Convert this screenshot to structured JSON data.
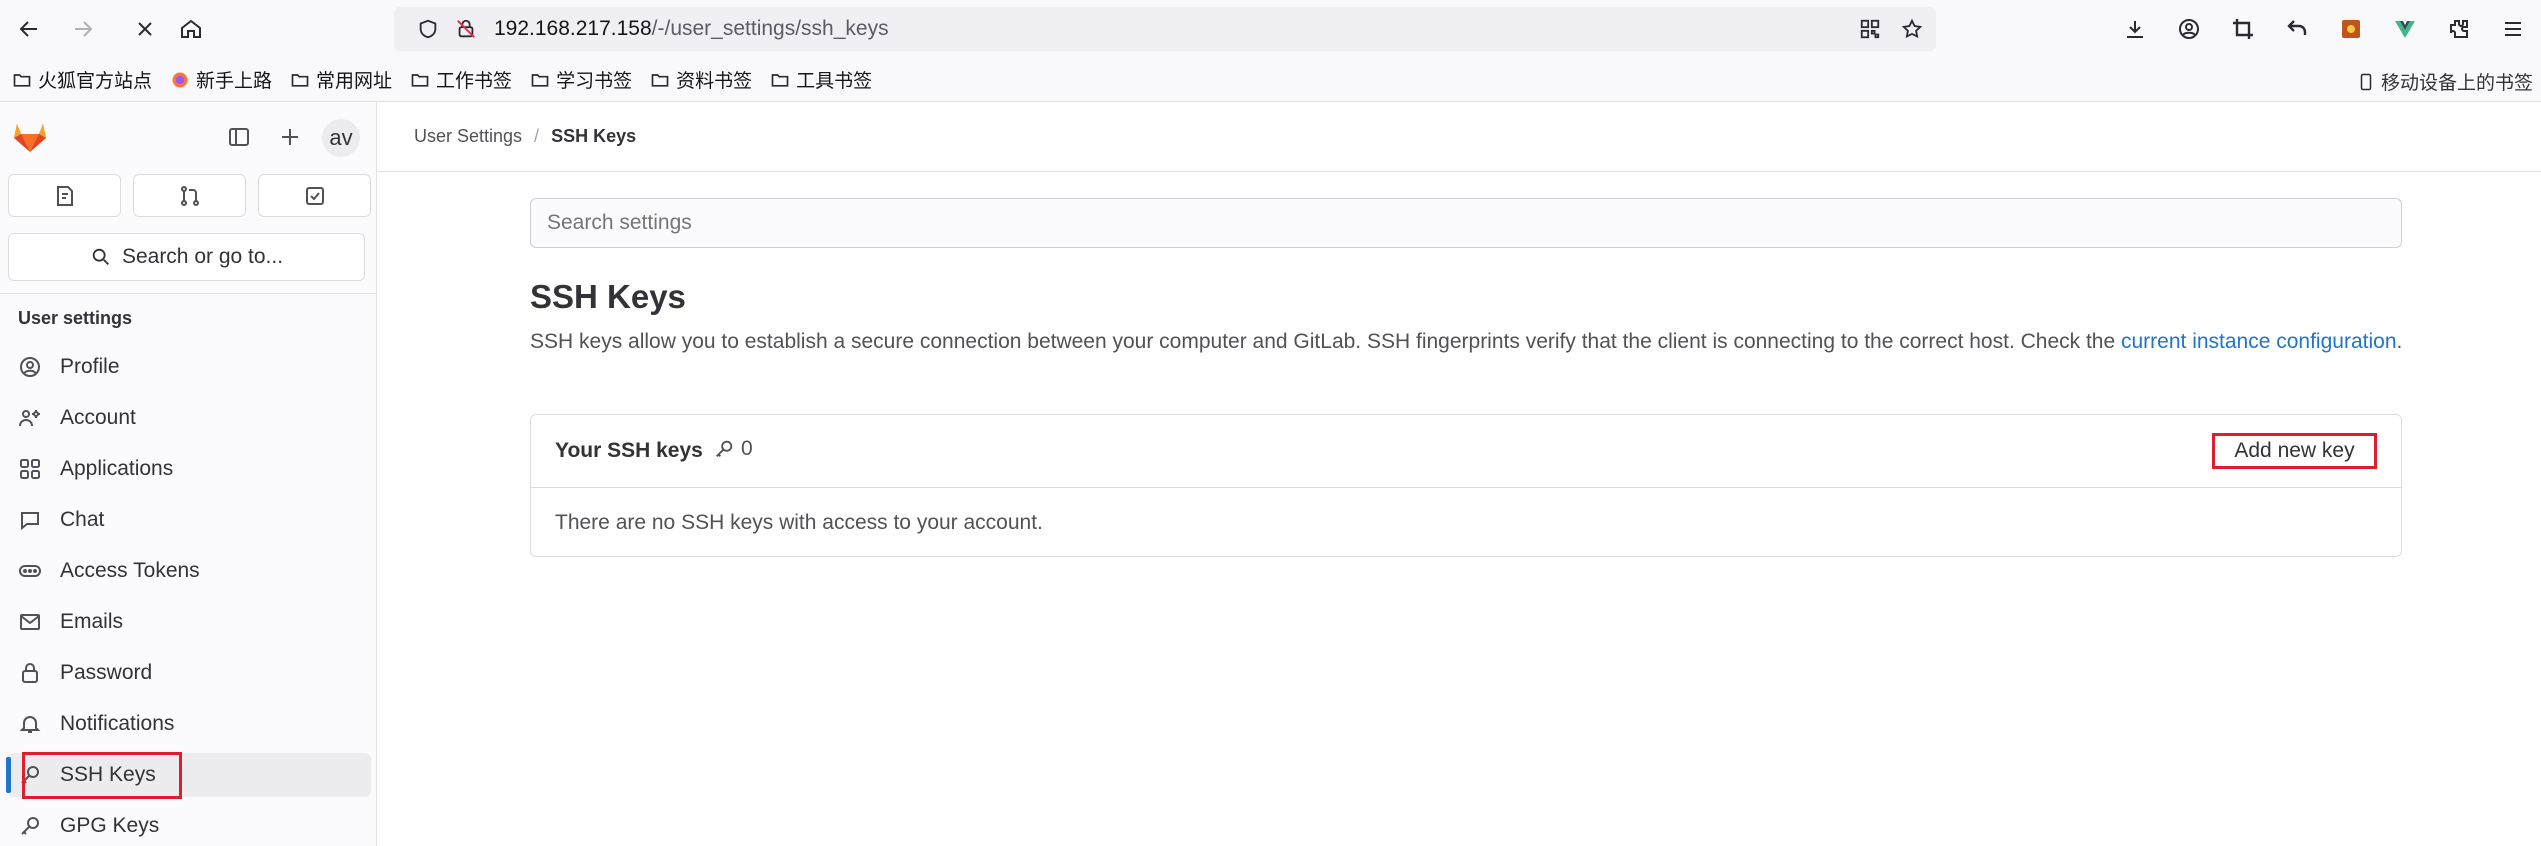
{
  "browser": {
    "url_host": "192.168.217.158",
    "url_path": "/-/user_settings/ssh_keys",
    "bookmarks": [
      "火狐官方站点",
      "新手上路",
      "常用网址",
      "工作书签",
      "学习书签",
      "资料书签",
      "工具书签"
    ],
    "mobile_bookmarks": "移动设备上的书签"
  },
  "sidebar": {
    "avatar_text": "av",
    "search_label": "Search or go to...",
    "section_title": "User settings",
    "items": [
      {
        "label": "Profile",
        "icon": "profile-icon"
      },
      {
        "label": "Account",
        "icon": "account-icon"
      },
      {
        "label": "Applications",
        "icon": "applications-icon"
      },
      {
        "label": "Chat",
        "icon": "chat-icon"
      },
      {
        "label": "Access Tokens",
        "icon": "token-icon"
      },
      {
        "label": "Emails",
        "icon": "mail-icon"
      },
      {
        "label": "Password",
        "icon": "lock-icon"
      },
      {
        "label": "Notifications",
        "icon": "bell-icon"
      },
      {
        "label": "SSH Keys",
        "icon": "key-icon",
        "active": true
      },
      {
        "label": "GPG Keys",
        "icon": "key-icon"
      }
    ]
  },
  "main": {
    "breadcrumb": {
      "parent": "User Settings",
      "separator": "/",
      "current": "SSH Keys"
    },
    "search_placeholder": "Search settings",
    "title": "SSH Keys",
    "description": "SSH keys allow you to establish a secure connection between your computer and GitLab. SSH fingerprints verify that the client is connecting to the correct host. Check the ",
    "description_link": "current instance configuration",
    "description_end": ".",
    "card": {
      "title": "Your SSH keys",
      "count": "0",
      "add_button": "Add new key",
      "empty_text": "There are no SSH keys with access to your account."
    }
  },
  "colors": {
    "accent": "#1f75cb",
    "highlight": "#dd1e2f"
  }
}
